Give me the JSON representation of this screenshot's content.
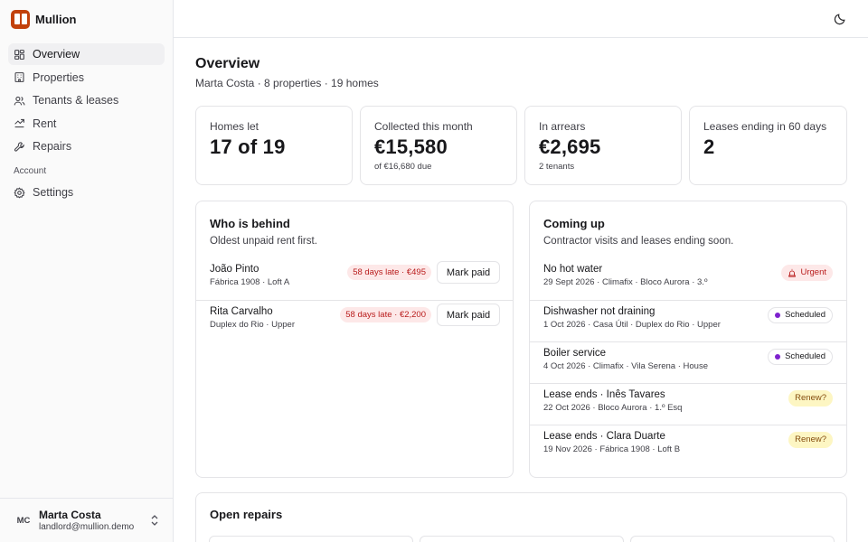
{
  "brand": {
    "name": "Mullion",
    "accent": "#c2410c"
  },
  "sidebar": {
    "items": [
      {
        "label": "Overview",
        "icon": "layout-dashboard-icon",
        "active": true
      },
      {
        "label": "Properties",
        "icon": "building-icon",
        "active": false
      },
      {
        "label": "Tenants & leases",
        "icon": "users-icon",
        "active": false
      },
      {
        "label": "Rent",
        "icon": "receipt-icon",
        "active": false
      },
      {
        "label": "Repairs",
        "icon": "wrench-icon",
        "active": false
      }
    ],
    "section": "Account",
    "account_items": [
      {
        "label": "Settings",
        "icon": "gear-icon"
      }
    ],
    "user": {
      "initials": "MC",
      "name": "Marta Costa",
      "email": "landlord@mullion.demo"
    }
  },
  "topbar": {
    "theme_icon": "moon-icon"
  },
  "page": {
    "title": "Overview",
    "subtitle": "Marta Costa · 8 properties · 19 homes"
  },
  "stats": [
    {
      "label": "Homes let",
      "value": "17 of 19",
      "note": ""
    },
    {
      "label": "Collected this month",
      "value": "€15,580",
      "note": "of €16,680 due"
    },
    {
      "label": "In arrears",
      "value": "€2,695",
      "note": "2 tenants"
    },
    {
      "label": "Leases ending in 60 days",
      "value": "2",
      "note": ""
    }
  ],
  "behind": {
    "title": "Who is behind",
    "subtitle": "Oldest unpaid rent first.",
    "button_label": "Mark paid",
    "rows": [
      {
        "name": "João Pinto",
        "place": "Fábrica 1908 · Loft A",
        "badge": "58 days late · €495"
      },
      {
        "name": "Rita Carvalho",
        "place": "Duplex do Rio · Upper",
        "badge": "58 days late · €2,200"
      }
    ]
  },
  "coming": {
    "title": "Coming up",
    "subtitle": "Contractor visits and leases ending soon.",
    "rows": [
      {
        "title": "No hot water",
        "meta": "29 Sept 2026 · Climafix · Bloco Aurora · 3.º",
        "badge": "Urgent",
        "kind": "urgent"
      },
      {
        "title": "Dishwasher not draining",
        "meta": "1 Oct 2026 · Casa Útil · Duplex do Rio · Upper",
        "badge": "Scheduled",
        "kind": "scheduled"
      },
      {
        "title": "Boiler service",
        "meta": "4 Oct 2026 · Climafix · Vila Serena · House",
        "badge": "Scheduled",
        "kind": "scheduled"
      },
      {
        "title": "Lease ends · Inês Tavares",
        "meta": "22 Oct 2026 · Bloco Aurora · 1.º Esq",
        "badge": "Renew?",
        "kind": "renew"
      },
      {
        "title": "Lease ends · Clara Duarte",
        "meta": "19 Nov 2026 · Fábrica 1908 · Loft B",
        "badge": "Renew?",
        "kind": "renew"
      }
    ]
  },
  "repairs": {
    "title": "Open repairs"
  },
  "colors": {
    "urgent": "#b91c1c",
    "scheduled_dot": "#7e22ce",
    "renew": "#854d0e"
  }
}
